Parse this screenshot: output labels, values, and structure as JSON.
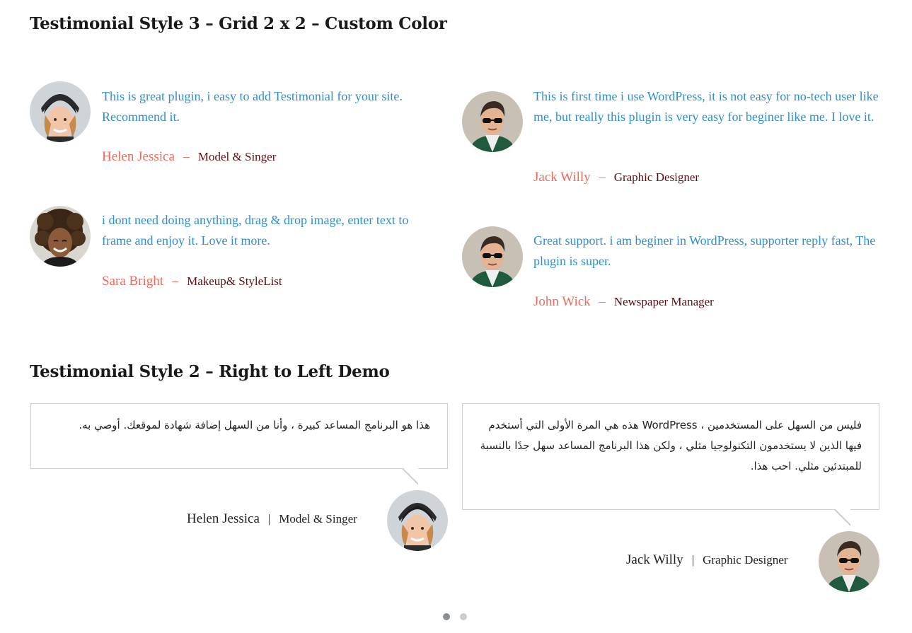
{
  "section3": {
    "title": "Testimonial Style 3 – Grid 2 x 2 – Custom Color",
    "items": [
      {
        "text": "This is great plugin, i easy to add Testimonial for your site. Recommend it.",
        "name": "Helen Jessica",
        "sep": "–",
        "role": "Model & Singer",
        "avatar": "woman-beanie-avatar"
      },
      {
        "text": "This is first time i use WordPress, it is not easy for no-tech user like me, but really this plugin is very easy for beginer like me. I love it.",
        "name": "Jack Willy",
        "sep": "–",
        "role": "Graphic Designer",
        "avatar": "man-sunglasses-avatar"
      },
      {
        "text": "i dont need doing anything, drag & drop image, enter text to frame and enjoy it. Love it more.",
        "name": "Sara Bright",
        "sep": "–",
        "role": "Makeup& StyleList",
        "avatar": "woman-curly-avatar"
      },
      {
        "text": "Great support. i am beginer in WordPress, supporter reply fast, The plugin is super.",
        "name": "John Wick",
        "sep": "–",
        "role": "Newspaper Manager",
        "avatar": "man-sunglasses-avatar"
      }
    ]
  },
  "section2": {
    "title": "Testimonial Style 2 – Right to Left Demo",
    "items": [
      {
        "text": "هذا هو البرنامج المساعد كبيرة ، وأنا من السهل إضافة شهادة لموقعك. أوصي به.",
        "name": "Helen Jessica",
        "sep": "|",
        "role": "Model & Singer",
        "avatar": "woman-beanie-avatar"
      },
      {
        "text": "فليس من السهل على المستخدمين ، WordPress هذه هي المرة الأولى التي أستخدم فيها الذين لا يستخدمون التكنولوجيا مثلي ، ولكن هذا البرنامج المساعد سهل جدًا بالنسبة للمبتدئين مثلي. احب هذا.",
        "name": "Jack Willy",
        "sep": "|",
        "role": "Graphic Designer",
        "avatar": "man-sunglasses-avatar"
      }
    ],
    "pagination": {
      "pages": 2,
      "active": 1
    }
  },
  "colors": {
    "quote_text": "#2f8fc8",
    "name": "#ee6a5a",
    "role": "#5a1018",
    "dot_active": "#8a8f93",
    "dot_inactive": "#c9cdd0"
  }
}
